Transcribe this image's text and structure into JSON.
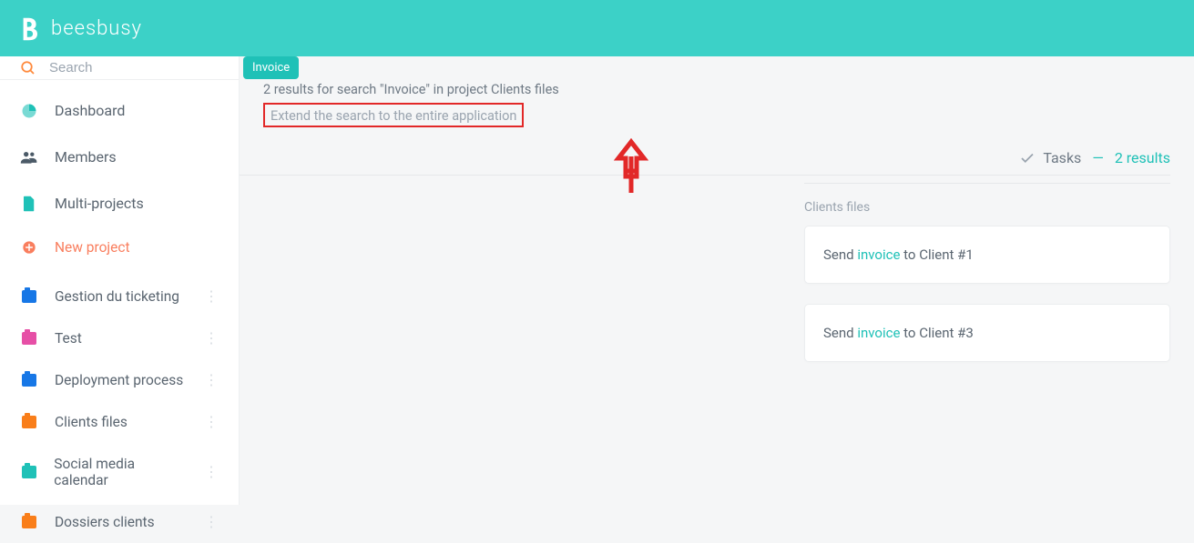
{
  "brand": {
    "name": "beesbusy"
  },
  "search": {
    "placeholder": "Search",
    "tag": "Invoice"
  },
  "nav_primary": [
    {
      "label": "Dashboard"
    },
    {
      "label": "Members"
    },
    {
      "label": "Multi-projects"
    }
  ],
  "nav_new_project": "New project",
  "projects": [
    {
      "label": "Gestion du ticketing",
      "color": "#1777e6"
    },
    {
      "label": "Test",
      "color": "#e64fa6"
    },
    {
      "label": "Deployment process",
      "color": "#1777e6"
    },
    {
      "label": "Clients files",
      "color": "#f97e1a"
    },
    {
      "label": "Social media calendar",
      "color": "#1fc1b7"
    },
    {
      "label": "Dossiers clients",
      "color": "#f97e1a"
    }
  ],
  "results": {
    "summary": "2 results for search \"Invoice\" in project Clients files",
    "extend": "Extend the search to the entire application",
    "tasks_label": "Tasks",
    "count_label": "2 results",
    "group_title": "Clients files",
    "cards": [
      {
        "pre": "Send ",
        "match": "invoice",
        "post": " to Client #1"
      },
      {
        "pre": "Send ",
        "match": "invoice",
        "post": " to Client #3"
      }
    ]
  }
}
